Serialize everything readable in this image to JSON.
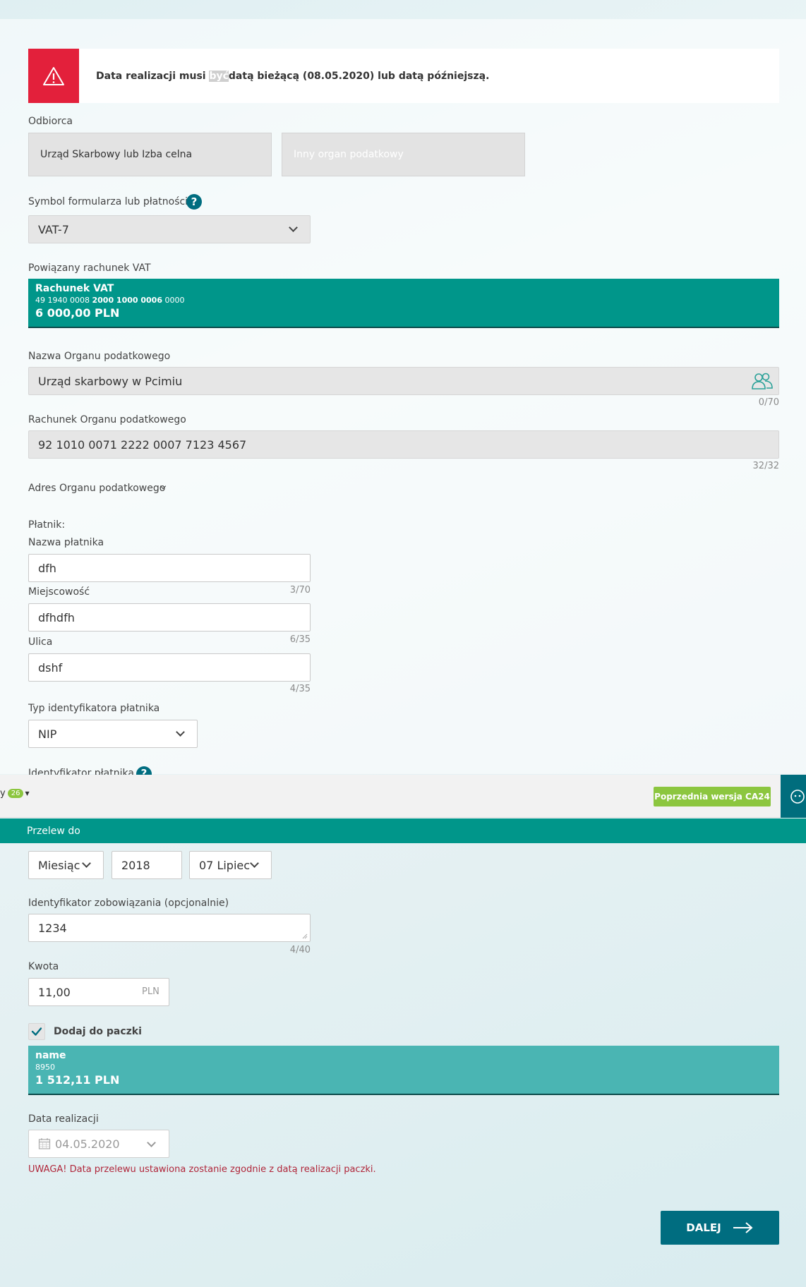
{
  "alert": {
    "text_before": "Data realizacji musi ",
    "text_highlight": "być",
    "text_after": "datą bieżącą (08.05.2020) lub datą późniejszą."
  },
  "recipient": {
    "label": "Odbiorca",
    "option_selected": "Urząd Skarbowy lub Izba celna",
    "option_other": "Inny organ podatkowy"
  },
  "form_symbol": {
    "label": "Symbol formularza lub płatności",
    "value": "VAT-7"
  },
  "linked_account": {
    "label": "Powiązany rachunek VAT",
    "name": "Rachunek VAT",
    "number_a": "49 1940 0008 ",
    "number_b": "2000 1000 0006",
    "number_c": " 0000",
    "balance": "6 000,00 PLN",
    "color": "#00968a"
  },
  "tax_office_name": {
    "label": "Nazwa Organu podatkowego",
    "value": "Urząd skarbowy w Pcimiu",
    "counter": "0/70"
  },
  "tax_office_account": {
    "label": "Rachunek Organu podatkowego",
    "value": "92 1010 0071 2222 0007 7123 4567",
    "counter": "32/32"
  },
  "address_toggle": "Adres Organu podatkowego",
  "payer": {
    "section_label": "Płatnik:",
    "name_label": "Nazwa płatnika",
    "name_value": "dfh",
    "name_counter": "3/70",
    "city_label": "Miejscowość",
    "city_value": "dfhdfh",
    "city_counter": "6/35",
    "street_label": "Ulica",
    "street_value": "dshf",
    "street_counter": "4/35",
    "id_type_label": "Typ identyfikatora płatnika",
    "id_type_value": "NIP",
    "identifier_label": "Identyfikator płatnika"
  },
  "topbar": {
    "partial_label": "y",
    "badge": "26",
    "prev_version": "Poprzednia wersja CA24"
  },
  "greenbar": "Przelew do",
  "period": {
    "type": "Miesiąc",
    "year": "2018",
    "month": "07 Lipiec"
  },
  "obligation_id": {
    "label": "Identyfikator zobowiązania (opcjonalnie)",
    "value": "1234",
    "counter": "4/40"
  },
  "amount": {
    "label": "Kwota",
    "value": "11,00",
    "currency": "PLN"
  },
  "package": {
    "checkbox_label": "Dodaj do paczki",
    "checked": true,
    "name": "name",
    "number": "8950",
    "balance": "1 512,11 PLN",
    "color": "#4ab5b3"
  },
  "execution_date": {
    "label": "Data realizacji",
    "value": "04.05.2020",
    "warning": "UWAGA! Data przelewu ustawiona zostanie zgodnie z datą realizacji paczki."
  },
  "next_button": "DALEJ"
}
